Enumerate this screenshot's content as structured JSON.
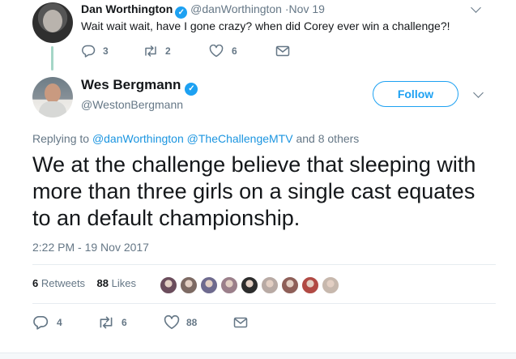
{
  "parent_tweet": {
    "name": "Dan Worthington",
    "handle": "@danWorthington",
    "separator": "·",
    "time": "Nov 19",
    "text": "Wait wait wait, have I gone crazy? when did Corey ever win a challenge?!",
    "actions": {
      "replies": "3",
      "retweets": "2",
      "likes": "6"
    }
  },
  "main_tweet": {
    "name": "Wes Bergmann",
    "handle": "@WestonBergmann",
    "follow_label": "Follow",
    "replying_prefix": "Replying to",
    "replying_mentions": [
      "@danWorthington",
      "@TheChallengeMTV"
    ],
    "replying_suffix": "and 8 others",
    "text": "We at the challenge believe that sleeping with more than three girls on a single cast equates to an default championship.",
    "timestamp": "2:22 PM - 19 Nov 2017",
    "stats": {
      "retweets_count": "6",
      "retweets_label": "Retweets",
      "likes_count": "88",
      "likes_label": "Likes"
    },
    "liker_colors": [
      "#6b4d5c",
      "#7d6a63",
      "#6e6a8e",
      "#9b7f8a",
      "#2c2c2c",
      "#b8aaa4",
      "#8e5f58",
      "#b14a44",
      "#c7b8ad"
    ],
    "actions": {
      "replies": "4",
      "retweets": "6",
      "likes": "88"
    }
  },
  "colors": {
    "accent": "#1da1f2",
    "mention": "#1b95e0",
    "muted": "#657786",
    "thread_line": "#a5d6c7"
  }
}
